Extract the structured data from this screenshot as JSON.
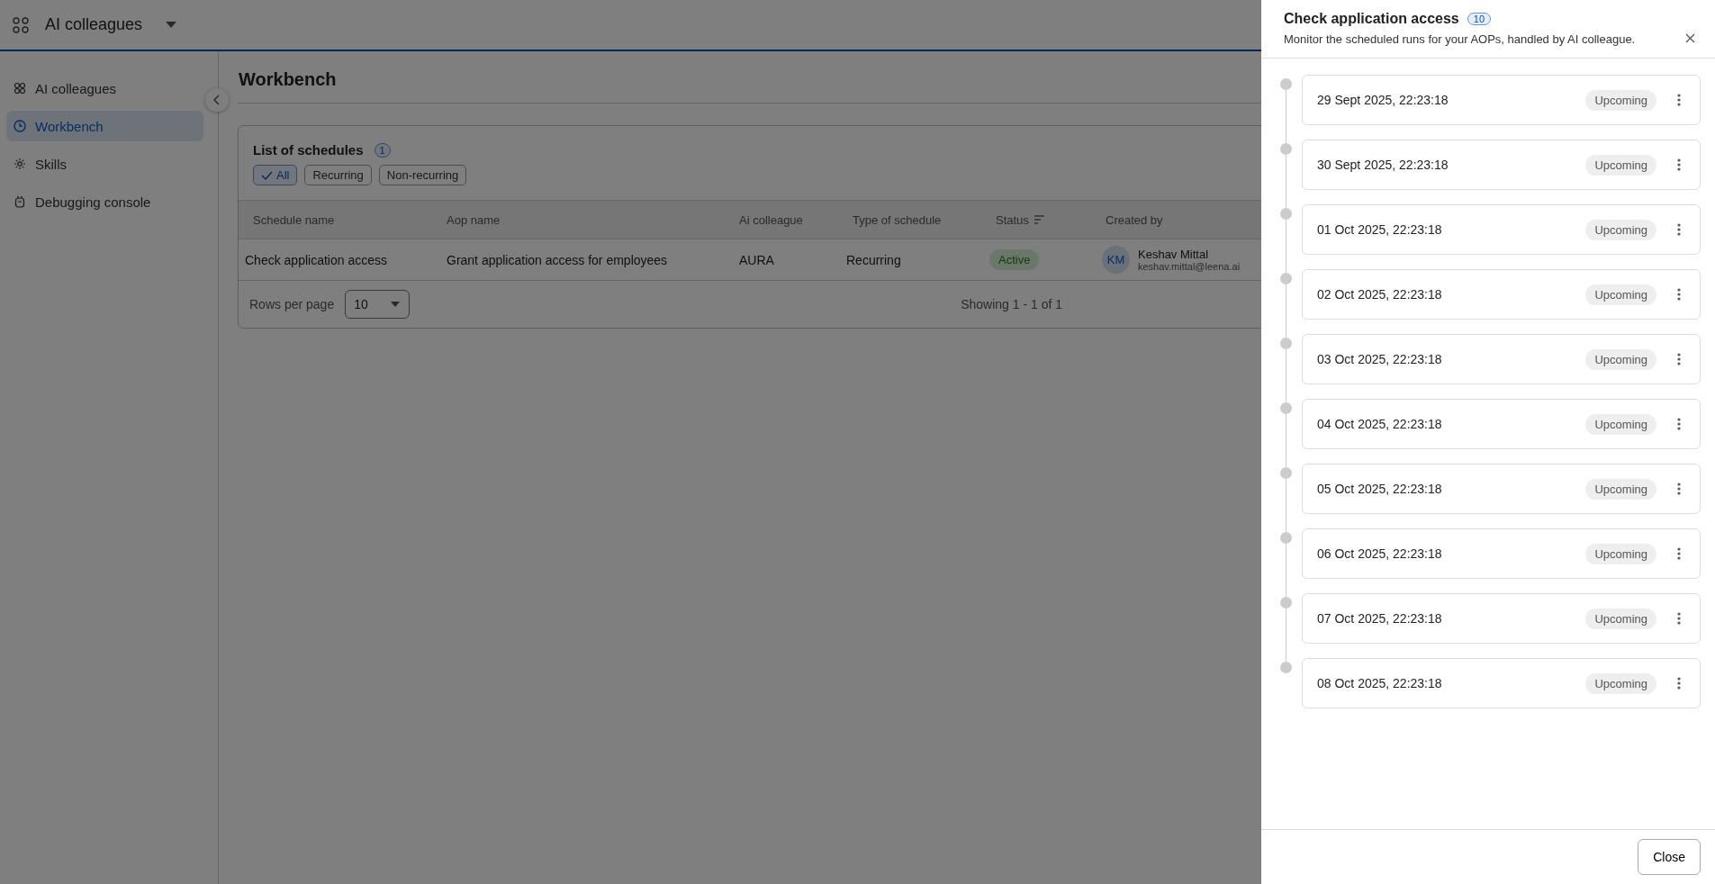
{
  "app": {
    "title": "AI colleagues"
  },
  "sidebar": {
    "items": [
      {
        "label": "AI colleagues",
        "kind": "colleagues",
        "selected": false
      },
      {
        "label": "Workbench",
        "kind": "clock",
        "selected": true
      },
      {
        "label": "Skills",
        "kind": "gear",
        "selected": false
      },
      {
        "label": "Debugging console",
        "kind": "bot",
        "selected": false
      }
    ]
  },
  "page": {
    "title": "Workbench"
  },
  "schedules": {
    "title": "List of schedules",
    "count": "1",
    "filters": [
      {
        "label": "All",
        "selected": true
      },
      {
        "label": "Recurring",
        "selected": false
      },
      {
        "label": "Non-recurring",
        "selected": false
      }
    ],
    "columns": [
      {
        "label": "Schedule name",
        "sortable": false
      },
      {
        "label": "Aop name",
        "sortable": false
      },
      {
        "label": "Ai colleague",
        "sortable": false
      },
      {
        "label": "Type of schedule",
        "sortable": false
      },
      {
        "label": "Status",
        "sortable": true
      },
      {
        "label": "Created by",
        "sortable": false
      }
    ],
    "rows": [
      {
        "schedule_name": "Check application access",
        "aop_name": "Grant application access for employees",
        "ai_colleague": "AURA",
        "type": "Recurring",
        "status": "Active",
        "created_by": {
          "initials": "KM",
          "name": "Keshav Mittal",
          "email": "keshav.mittal@leena.ai"
        }
      }
    ],
    "rows_per_page": {
      "label": "Rows per page",
      "value": "10"
    },
    "showing": "Showing 1 - 1 of 1"
  },
  "drawer": {
    "title": "Check application access",
    "count": "10",
    "subtitle": "Monitor the scheduled runs for your AOPs, handled by AI colleague.",
    "runs": [
      {
        "time": "29 Sept 2025, 22:23:18",
        "status": "Upcoming"
      },
      {
        "time": "30 Sept 2025, 22:23:18",
        "status": "Upcoming"
      },
      {
        "time": "01 Oct 2025, 22:23:18",
        "status": "Upcoming"
      },
      {
        "time": "02 Oct 2025, 22:23:18",
        "status": "Upcoming"
      },
      {
        "time": "03 Oct 2025, 22:23:18",
        "status": "Upcoming"
      },
      {
        "time": "04 Oct 2025, 22:23:18",
        "status": "Upcoming"
      },
      {
        "time": "05 Oct 2025, 22:23:18",
        "status": "Upcoming"
      },
      {
        "time": "06 Oct 2025, 22:23:18",
        "status": "Upcoming"
      },
      {
        "time": "07 Oct 2025, 22:23:18",
        "status": "Upcoming"
      },
      {
        "time": "08 Oct 2025, 22:23:18",
        "status": "Upcoming"
      }
    ],
    "close_button": "Close"
  }
}
